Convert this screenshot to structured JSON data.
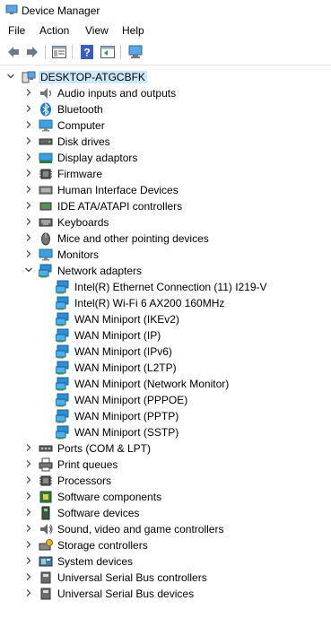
{
  "window": {
    "title": "Device Manager"
  },
  "menu": [
    "File",
    "Action",
    "View",
    "Help"
  ],
  "toolbar": [
    "back-icon",
    "forward-icon",
    "properties-icon",
    "help-icon",
    "update-driver-icon",
    "scan-hardware-icon"
  ],
  "root": {
    "label": "DESKTOP-ATGCBFK",
    "icon": "computer-icon"
  },
  "categories": [
    {
      "label": "Audio inputs and outputs",
      "icon": "audio-icon"
    },
    {
      "label": "Bluetooth",
      "icon": "bluetooth-icon"
    },
    {
      "label": "Computer",
      "icon": "monitor-icon"
    },
    {
      "label": "Disk drives",
      "icon": "disk-icon"
    },
    {
      "label": "Display adaptors",
      "icon": "display-adapter-icon"
    },
    {
      "label": "Firmware",
      "icon": "chip-icon"
    },
    {
      "label": "Human Interface Devices",
      "icon": "hid-icon"
    },
    {
      "label": "IDE ATA/ATAPI controllers",
      "icon": "ide-icon"
    },
    {
      "label": "Keyboards",
      "icon": "keyboard-icon"
    },
    {
      "label": "Mice and other pointing devices",
      "icon": "mouse-icon"
    },
    {
      "label": "Monitors",
      "icon": "monitor-icon"
    },
    {
      "label": "Network adapters",
      "icon": "network-icon",
      "expanded": true,
      "children": [
        "Intel(R) Ethernet Connection (11) I219-V",
        "Intel(R) Wi-Fi 6 AX200 160MHz",
        "WAN Miniport (IKEv2)",
        "WAN Miniport (IP)",
        "WAN Miniport (IPv6)",
        "WAN Miniport (L2TP)",
        "WAN Miniport (Network Monitor)",
        "WAN Miniport (PPPOE)",
        "WAN Miniport (PPTP)",
        "WAN Miniport (SSTP)"
      ]
    },
    {
      "label": "Ports (COM & LPT)",
      "icon": "port-icon"
    },
    {
      "label": "Print queues",
      "icon": "printer-icon"
    },
    {
      "label": "Processors",
      "icon": "chip-icon"
    },
    {
      "label": "Software components",
      "icon": "component-icon"
    },
    {
      "label": "Software devices",
      "icon": "software-device-icon"
    },
    {
      "label": "Sound, video and game controllers",
      "icon": "speaker-icon"
    },
    {
      "label": "Storage controllers",
      "icon": "storage-icon"
    },
    {
      "label": "System devices",
      "icon": "system-icon"
    },
    {
      "label": "Universal Serial Bus controllers",
      "icon": "usb-icon"
    },
    {
      "label": "Universal Serial Bus devices",
      "icon": "usb-icon"
    }
  ],
  "colors": {
    "selection": "#cce8ff",
    "network": "#2d8fd6",
    "monitor": "#3aa0e0"
  }
}
